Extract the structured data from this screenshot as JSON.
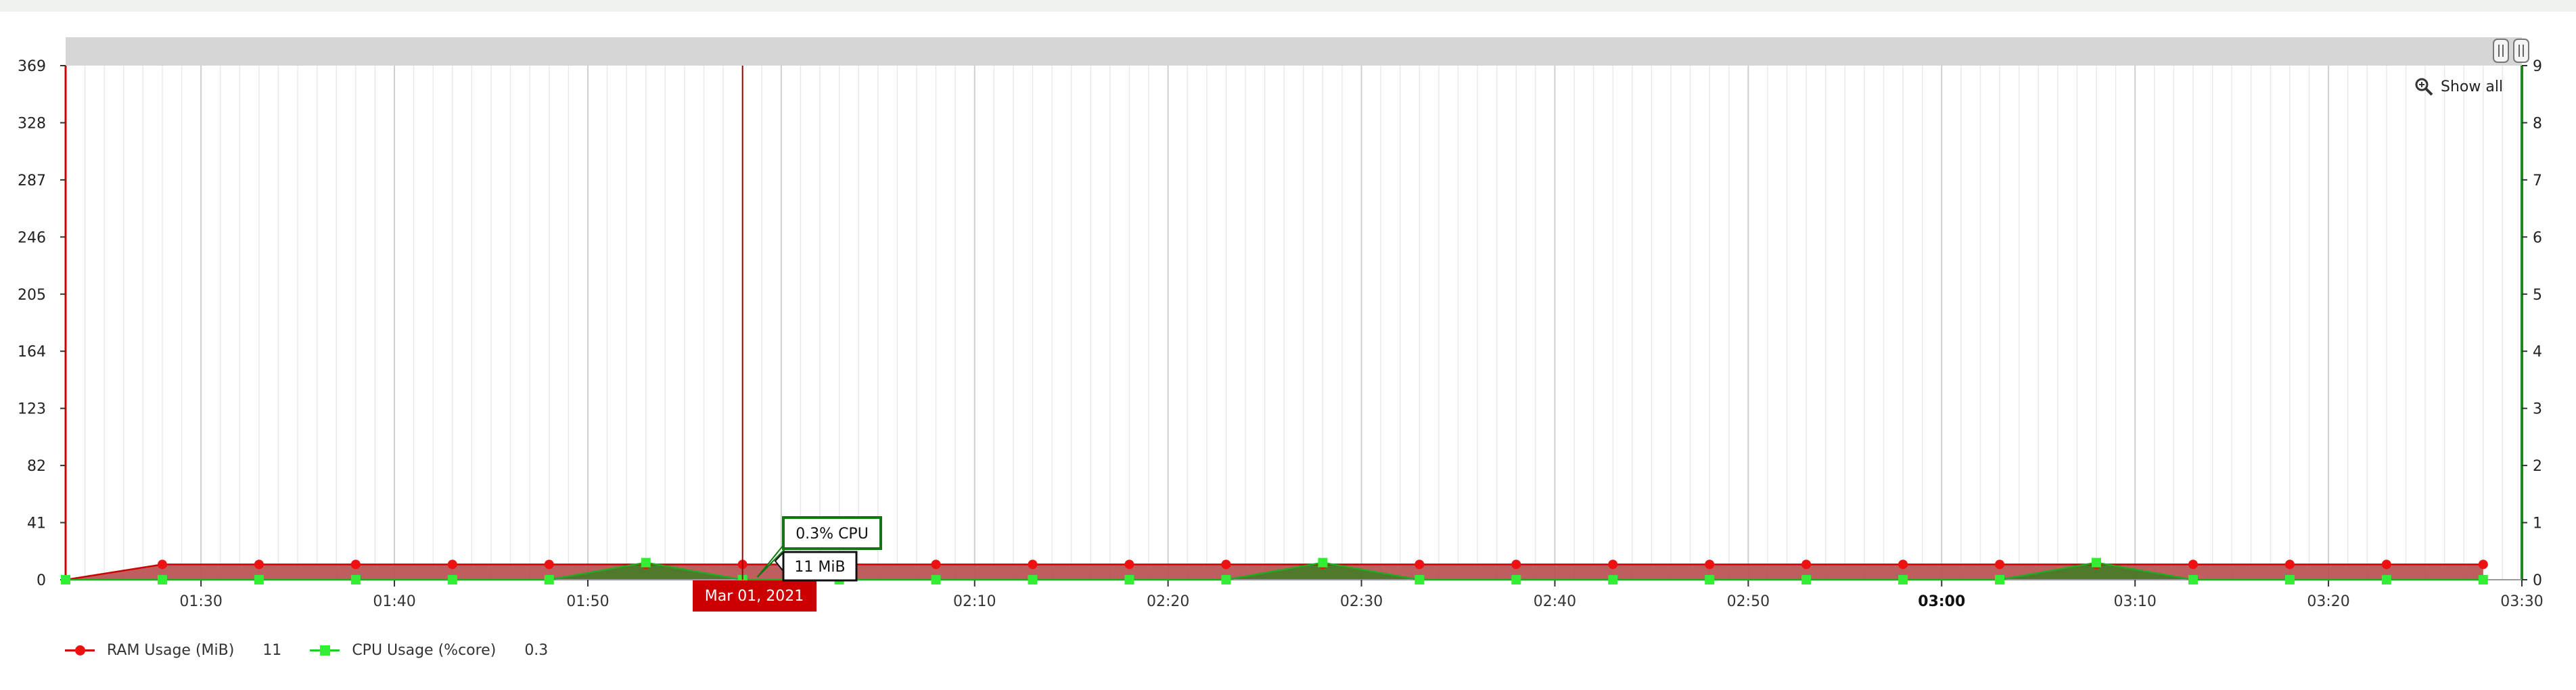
{
  "chart_data": {
    "type": "line",
    "x_start": "01:23",
    "x_step_minutes": 5,
    "x_ticks": [
      "01:30",
      "01:40",
      "01:50",
      "02:00",
      "02:10",
      "02:20",
      "02:30",
      "02:40",
      "02:50",
      "03:00",
      "03:10",
      "03:20",
      "03:30"
    ],
    "x_tick_bold": "03:00",
    "y_left_ticks": [
      0,
      41,
      82,
      123,
      164,
      205,
      246,
      287,
      328,
      369
    ],
    "y_left_range": [
      0,
      369
    ],
    "y_right_ticks": [
      0,
      1,
      2,
      3,
      4,
      5,
      6,
      7,
      8,
      9
    ],
    "y_right_range": [
      0,
      9
    ],
    "grid": "vertical",
    "legend_position": "bottom-left",
    "series": [
      {
        "name": "RAM Usage (MiB)",
        "axis": "left",
        "color": "#cc0000",
        "fill": "#b84c4c",
        "marker": "circle",
        "marker_color": "#ee1111",
        "current_value": "11",
        "values": [
          0,
          11,
          11,
          11,
          11,
          11,
          11,
          11,
          11,
          11,
          11,
          11,
          11,
          11,
          11,
          11,
          11,
          11,
          11,
          11,
          11,
          11,
          11,
          11,
          11,
          11
        ]
      },
      {
        "name": "CPU Usage (%core)",
        "axis": "right",
        "color": "#22aa22",
        "fill": "#4a7a2a",
        "marker": "square",
        "marker_color": "#33ee33",
        "current_value": "0.3",
        "values": [
          0,
          0,
          0,
          0,
          0,
          0,
          0.3,
          0,
          0,
          0,
          0,
          0,
          0,
          0.3,
          0,
          0,
          0,
          0,
          0,
          0,
          0,
          0.3,
          0,
          0,
          0,
          0
        ]
      }
    ],
    "cursor": {
      "date_label": "Mar 01, 2021",
      "index": 7,
      "ram_label": "11 MiB",
      "cpu_label": "0.3% CPU"
    }
  },
  "controls": {
    "show_all_label": "Show all"
  },
  "colors": {
    "ram_axis": "#cc0000",
    "cpu_axis": "#1e8a1e",
    "scrollbar": "#d8d8d8",
    "tooltip_red": "#cc0000",
    "tooltip_green": "#117711"
  }
}
